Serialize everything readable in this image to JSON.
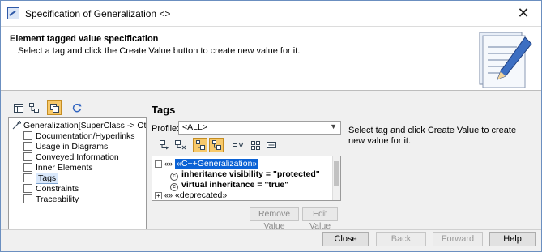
{
  "window": {
    "title": "Specification of Generalization <>",
    "close_glyph": "✕"
  },
  "header": {
    "title": "Element tagged value specification",
    "subtitle": "Select a tag and click the Create Value button to create new value for it."
  },
  "left_tree": {
    "root": "Generalization[SuperClass -> OtherBas",
    "items": [
      {
        "label": "Documentation/Hyperlinks"
      },
      {
        "label": "Usage in Diagrams"
      },
      {
        "label": "Conveyed Information"
      },
      {
        "label": "Inner Elements"
      },
      {
        "label": "Tags",
        "selected": true
      },
      {
        "label": "Constraints"
      },
      {
        "label": "Traceability"
      }
    ]
  },
  "tags_panel": {
    "title": "Tags",
    "profile_label": "Profile:",
    "profile_value": "<ALL>",
    "hint": "Select tag and click Create Value to create new value for it.",
    "tree": {
      "group1": "«C++Generalization»",
      "prop1": "inheritance visibility = \"protected\"",
      "prop2": "virtual inheritance = \"true\"",
      "group2": "«deprecated»"
    },
    "remove_value": "Remove Value",
    "edit_value": "Edit Value"
  },
  "footer": {
    "close": "Close",
    "back": "Back",
    "forward": "Forward",
    "help": "Help"
  }
}
